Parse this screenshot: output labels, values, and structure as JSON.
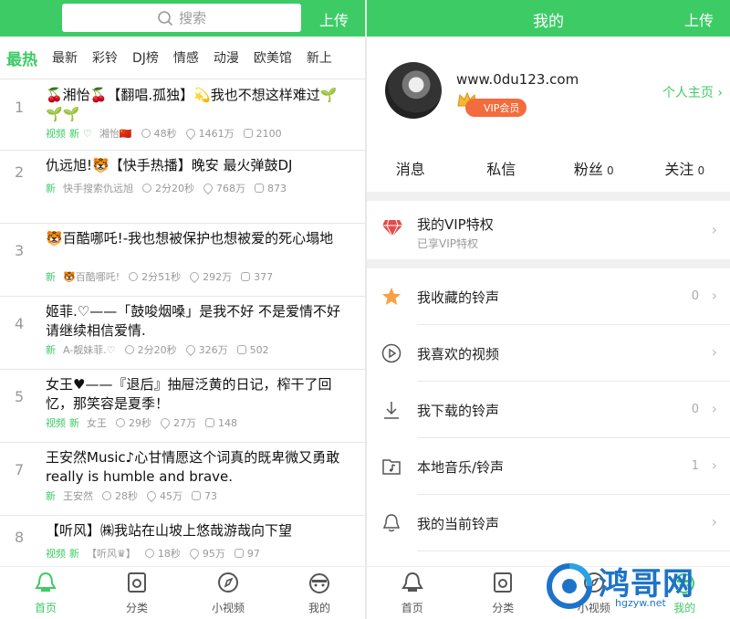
{
  "left": {
    "search_placeholder": "搜索",
    "upload": "上传",
    "tabs": [
      "最热",
      "最新",
      "彩铃",
      "DJ榜",
      "情感",
      "动漫",
      "欧美馆",
      "新上"
    ],
    "items": [
      {
        "rank": "1",
        "title": "🍒湘怡🍒【翻唱.孤独】💫我也不想这样难过🌱🌱🌱",
        "tags": [
          "视频",
          "新",
          "♡"
        ],
        "user": "湘怡🇨🇳",
        "duration": "48秒",
        "plays": "1461万",
        "comments": "2100"
      },
      {
        "rank": "2",
        "title": "仇远旭!🐯【快手热播】晚安 最火弹鼓DJ",
        "tags": [
          "新"
        ],
        "user": "快手搜索仇远旭",
        "duration": "2分20秒",
        "plays": "768万",
        "comments": "873"
      },
      {
        "rank": "3",
        "title": "🐯百酷哪吒!-我也想被保护也想被爱的死心塌地",
        "tags": [
          "新"
        ],
        "user": "🐯百酷哪吒!",
        "duration": "2分51秒",
        "plays": "292万",
        "comments": "377"
      },
      {
        "rank": "4",
        "title": "姬菲.♡——「鼓唆烟嗓」是我不好 不是爱情不好 请继续相信爱情.",
        "tags": [
          "新"
        ],
        "user": "A-靓妹菲.♡",
        "duration": "2分20秒",
        "plays": "326万",
        "comments": "502"
      },
      {
        "rank": "5",
        "title": "女王♥——『退后』抽屉泛黄的日记，榨干了回忆，那笑容是夏季！",
        "tags": [
          "视频",
          "新"
        ],
        "user": "女王",
        "duration": "29秒",
        "plays": "27万",
        "comments": "148"
      },
      {
        "rank": "7",
        "title": "王安然Music♪心甘情愿这个词真的既卑微又勇敢really is humble and brave.",
        "tags": [
          "新"
        ],
        "user": "王安然",
        "duration": "28秒",
        "plays": "45万",
        "comments": "73"
      },
      {
        "rank": "8",
        "title": "【听风】㈱我站在山坡上悠哉游哉向下望",
        "tags": [
          "视频",
          "新"
        ],
        "user": "【听风♛】",
        "duration": "18秒",
        "plays": "95万",
        "comments": "97"
      }
    ],
    "nav": [
      "首页",
      "分类",
      "小视频",
      "我的"
    ]
  },
  "right": {
    "title": "我的",
    "upload": "上传",
    "url": "www.0du123.com",
    "vip_badge": "VIP会员",
    "homepage": "个人主页",
    "stats": [
      {
        "label": "消息",
        "count": ""
      },
      {
        "label": "私信",
        "count": ""
      },
      {
        "label": "粉丝",
        "count": "0"
      },
      {
        "label": "关注",
        "count": "0"
      }
    ],
    "vip_row": {
      "label": "我的VIP特权",
      "sub": "已享VIP特权"
    },
    "menu": [
      {
        "label": "我收藏的铃声",
        "count": "0",
        "icon": "star-icon"
      },
      {
        "label": "我喜欢的视频",
        "count": "",
        "icon": "play-circle-icon"
      },
      {
        "label": "我下载的铃声",
        "count": "0",
        "icon": "download-icon"
      },
      {
        "label": "本地音乐/铃声",
        "count": "1",
        "icon": "music-folder-icon"
      },
      {
        "label": "我的当前铃声",
        "count": "",
        "icon": "bell-icon"
      }
    ],
    "nav": [
      "首页",
      "分类",
      "小视频",
      "我的"
    ],
    "watermark": "鸿哥网",
    "watermark_sub": "hgzyw.net"
  },
  "colors": {
    "accent": "#3dcb66",
    "vip": "#f36c3d",
    "watermark": "#1e73c8"
  }
}
